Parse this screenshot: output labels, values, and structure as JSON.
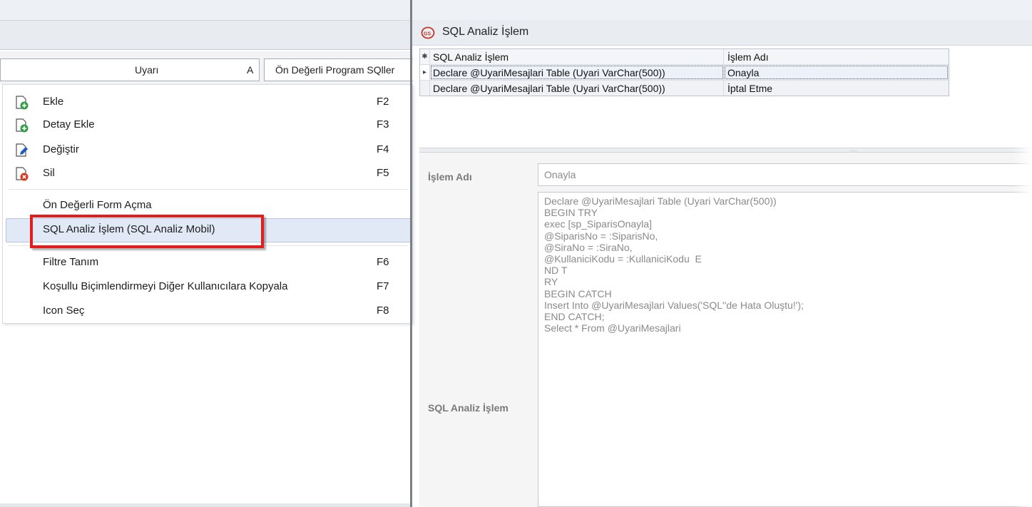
{
  "left_panel": {
    "columns": [
      {
        "label": "Uyarı"
      },
      {
        "label": "A"
      },
      {
        "label": "Ön Değerli Program SQller"
      }
    ]
  },
  "context_menu": {
    "items": [
      {
        "icon": "add-icon",
        "label": "Ekle",
        "shortcut": "F2"
      },
      {
        "icon": "add-detail-icon",
        "label": "Detay Ekle",
        "shortcut": "F3"
      },
      {
        "icon": "edit-icon",
        "label": "Değiştir",
        "shortcut": "F4"
      },
      {
        "icon": "delete-icon",
        "label": "Sil",
        "shortcut": "F5"
      },
      {
        "label": "Ön Değerli Form Açma",
        "shortcut": ""
      },
      {
        "label": "SQL Analiz İşlem (SQL Analiz Mobil)",
        "shortcut": "",
        "highlighted": true
      },
      {
        "label": "Filtre Tanım",
        "shortcut": "F6"
      },
      {
        "label": "Koşullu Biçimlendirmeyi Diğer Kullanıcılara Kopyala",
        "shortcut": "F7"
      },
      {
        "label": "Icon Seç",
        "shortcut": "F8"
      }
    ]
  },
  "right_window": {
    "title": "SQL Analiz İşlem",
    "grid": {
      "new_row_marker": "✱",
      "current_row_marker": "▸",
      "headers": [
        "SQL Analiz İşlem",
        "İşlem Adı"
      ],
      "rows": [
        [
          "Declare @UyariMesajlari Table (Uyari VarChar(500))",
          "Onayla"
        ],
        [
          "Declare @UyariMesajlari Table (Uyari VarChar(500))",
          "İptal Etme"
        ]
      ]
    },
    "splitter_grip": "::::::",
    "form": {
      "islem_adi_label": "İşlem Adı",
      "islem_adi_value": "Onayla",
      "sql_label": "SQL Analiz İşlem",
      "sql_lines": [
        "Declare @UyariMesajlari Table (Uyari VarChar(500))",
        "BEGIN TRY",
        "exec [sp_SiparisOnayla]",
        "@SiparisNo = :SiparisNo,",
        "@SiraNo = :SiraNo,",
        "@KullaniciKodu = :KullaniciKodu  E",
        "ND T",
        "RY",
        "BEGIN CATCH",
        "Insert Into @UyariMesajlari Values('SQL''de Hata Oluştu!');",
        "END CATCH;",
        "Select * From @UyariMesajlari"
      ]
    }
  },
  "colors": {
    "highlight_border": "#e31c1c",
    "menu_hover_bg": "#e2e9f6",
    "icon_green": "#2ea043",
    "icon_red": "#d9381e",
    "icon_blue": "#1e5bbf"
  }
}
